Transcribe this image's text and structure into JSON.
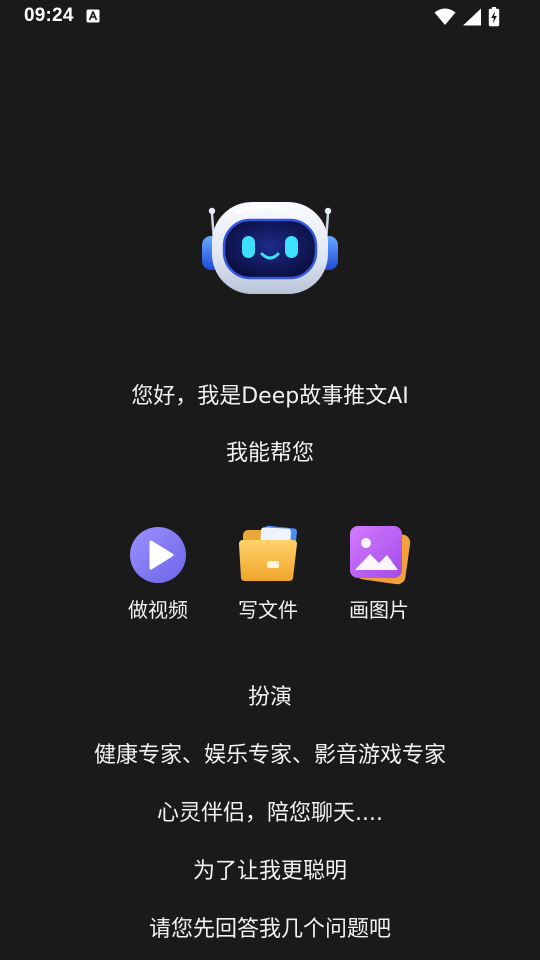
{
  "status_bar": {
    "time": "09:24",
    "icons": [
      "text-notification-icon",
      "wifi-icon",
      "cell-signal-icon",
      "battery-charging-icon"
    ]
  },
  "mascot": {
    "icon": "robot-mascot-icon"
  },
  "greeting": {
    "title": "您好，我是Deep故事推文AI",
    "subtitle": "我能帮您"
  },
  "features": [
    {
      "label": "做视频",
      "icon": "play-video-icon"
    },
    {
      "label": "写文件",
      "icon": "folder-icon"
    },
    {
      "label": "画图片",
      "icon": "image-gallery-icon"
    }
  ],
  "roleplay": {
    "heading": "扮演",
    "roles": "健康专家、娱乐专家、影音游戏专家",
    "companion": "心灵伴侣，陪您聊天....",
    "smarter": "为了让我更聪明",
    "prompt": "请您先回答我几个问题吧"
  },
  "colors": {
    "background": "#1a1a1a",
    "text": "#f2f2f2",
    "play_accent": "#7b73f0",
    "folder_accent": "#f5b942",
    "image_accent": "#b45cf0"
  }
}
